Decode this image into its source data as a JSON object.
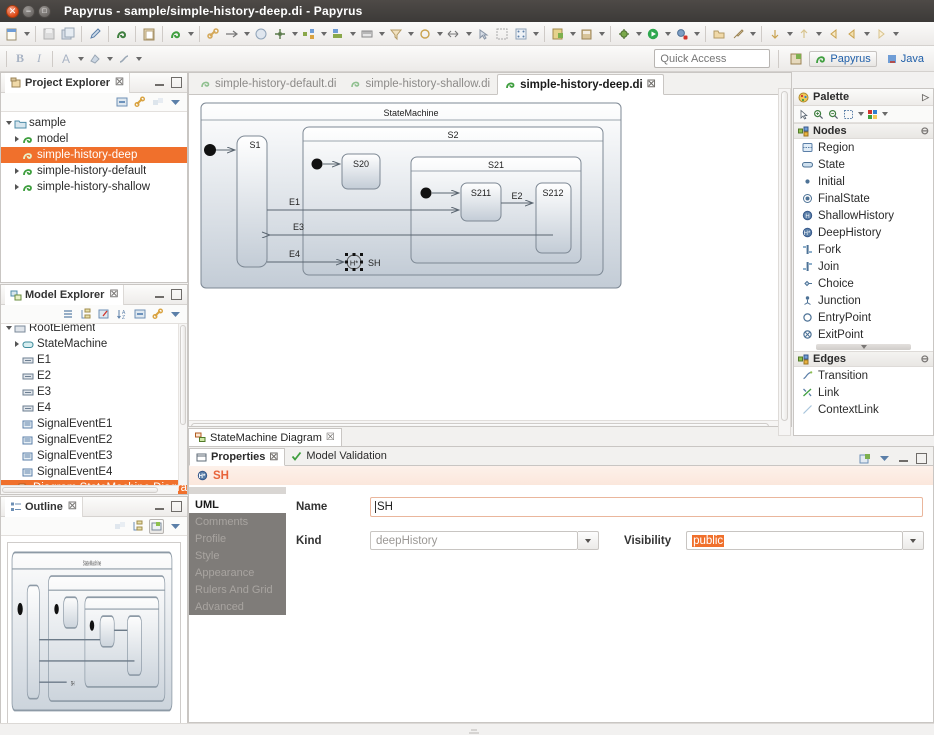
{
  "window": {
    "title": "Papyrus - sample/simple-history-deep.di - Papyrus",
    "buttons": {
      "close": "close-button",
      "minimize": "minimize-button",
      "maximize": "maximize-button"
    }
  },
  "toolbar": {
    "quick_access_placeholder": "Quick Access",
    "perspectives": [
      {
        "label": "Papyrus",
        "icon": "papyrus-icon",
        "active": true
      },
      {
        "label": "Java",
        "icon": "java-icon",
        "active": false
      }
    ],
    "open_perspective_label": "",
    "format": {
      "bold": "B",
      "italic": "I"
    }
  },
  "project_explorer": {
    "title": "Project Explorer",
    "close_glyph": "☒",
    "toolbar_icons": [
      "collapse-all-icon",
      "link-with-editor-icon",
      "view-menu-icon",
      "view-menu-chevron-icon"
    ],
    "items": [
      {
        "label": "sample",
        "depth": 0,
        "twisty": "down",
        "icon": "project-folder-icon",
        "selected": false
      },
      {
        "label": "model",
        "depth": 1,
        "twisty": "right",
        "icon": "papyrus-model-icon",
        "selected": false
      },
      {
        "label": "simple-history-deep",
        "depth": 1,
        "twisty": "none",
        "icon": "papyrus-model-icon",
        "selected": true
      },
      {
        "label": "simple-history-default",
        "depth": 1,
        "twisty": "right",
        "icon": "papyrus-model-icon",
        "selected": false
      },
      {
        "label": "simple-history-shallow",
        "depth": 1,
        "twisty": "right",
        "icon": "papyrus-model-icon",
        "selected": false
      }
    ]
  },
  "model_explorer": {
    "title": "Model Explorer",
    "close_glyph": "☒",
    "toolbar_icons": [
      "list-icon",
      "tree-icon",
      "edit-icon",
      "sort-icon",
      "collapse-all-icon",
      "link-icon",
      "view-menu-chevron-icon"
    ],
    "items": [
      {
        "label": "RootElement",
        "depth": 0,
        "twisty": "down",
        "icon": "model-icon",
        "selected": false,
        "clipped": true
      },
      {
        "label": "StateMachine",
        "depth": 1,
        "twisty": "right",
        "icon": "statemachine-icon",
        "selected": false
      },
      {
        "label": "E1",
        "depth": 1,
        "twisty": "none",
        "icon": "signal-icon",
        "selected": false
      },
      {
        "label": "E2",
        "depth": 1,
        "twisty": "none",
        "icon": "signal-icon",
        "selected": false
      },
      {
        "label": "E3",
        "depth": 1,
        "twisty": "none",
        "icon": "signal-icon",
        "selected": false
      },
      {
        "label": "E4",
        "depth": 1,
        "twisty": "none",
        "icon": "signal-icon",
        "selected": false
      },
      {
        "label": "SignalEventE1",
        "depth": 1,
        "twisty": "none",
        "icon": "signal-event-icon",
        "selected": false
      },
      {
        "label": "SignalEventE2",
        "depth": 1,
        "twisty": "none",
        "icon": "signal-event-icon",
        "selected": false
      },
      {
        "label": "SignalEventE3",
        "depth": 1,
        "twisty": "none",
        "icon": "signal-event-icon",
        "selected": false
      },
      {
        "label": "SignalEventE4",
        "depth": 1,
        "twisty": "none",
        "icon": "signal-event-icon",
        "selected": false
      },
      {
        "label": "Diagram StateMachine Diagra",
        "depth": 1,
        "twisty": "none",
        "icon": "diagram-icon",
        "selected": true
      }
    ]
  },
  "outline": {
    "title": "Outline",
    "close_glyph": "☒",
    "toolbar_icons": [
      "hide-icon",
      "tree-outline-icon",
      "overview-icon",
      "view-menu-chevron-icon"
    ]
  },
  "editor": {
    "tabs": [
      {
        "label": "simple-history-default.di",
        "active": false
      },
      {
        "label": "simple-history-shallow.di",
        "active": false
      },
      {
        "label": "simple-history-deep.di",
        "active": true,
        "close_glyph": "☒"
      }
    ],
    "bottom_tab": {
      "label": "StateMachine Diagram",
      "close_glyph": "☒",
      "icon": "diagram-icon"
    }
  },
  "diagram": {
    "root_label": "StateMachine",
    "states": [
      {
        "name": "S1"
      },
      {
        "name": "S2"
      },
      {
        "name": "S20"
      },
      {
        "name": "S21"
      },
      {
        "name": "S211"
      },
      {
        "name": "S212"
      }
    ],
    "transitions": [
      {
        "label": "E1"
      },
      {
        "label": "E2"
      },
      {
        "label": "E3"
      },
      {
        "label": "E4"
      }
    ],
    "history_node": {
      "label": "SH",
      "kind": "deepHistory",
      "selected": true
    }
  },
  "palette": {
    "title": "Palette",
    "pin_glyph": "▷",
    "tools": [
      "select-tool-icon",
      "zoom-in-icon",
      "zoom-out-icon",
      "marquee-icon",
      "marquee-caret-icon",
      "format-icon",
      "format-caret-icon"
    ],
    "groups": [
      {
        "name": "Nodes",
        "collapse_glyph": "⊖",
        "items": [
          {
            "label": "Region",
            "icon": "region-icon"
          },
          {
            "label": "State",
            "icon": "state-icon"
          },
          {
            "label": "Initial",
            "icon": "initial-icon"
          },
          {
            "label": "FinalState",
            "icon": "finalstate-icon"
          },
          {
            "label": "ShallowHistory",
            "icon": "shallowhistory-icon"
          },
          {
            "label": "DeepHistory",
            "icon": "deephistory-icon"
          },
          {
            "label": "Fork",
            "icon": "fork-icon"
          },
          {
            "label": "Join",
            "icon": "join-icon"
          },
          {
            "label": "Choice",
            "icon": "choice-icon"
          },
          {
            "label": "Junction",
            "icon": "junction-icon"
          },
          {
            "label": "EntryPoint",
            "icon": "entrypoint-icon"
          },
          {
            "label": "ExitPoint",
            "icon": "exitpoint-icon"
          }
        ]
      },
      {
        "name": "Edges",
        "collapse_glyph": "⊖",
        "items": [
          {
            "label": "Transition",
            "icon": "transition-icon"
          },
          {
            "label": "Link",
            "icon": "link-icon"
          },
          {
            "label": "ContextLink",
            "icon": "contextlink-icon"
          }
        ]
      }
    ]
  },
  "properties": {
    "tabs": [
      {
        "label": "Properties",
        "active": true,
        "close_glyph": "☒",
        "icon": "properties-icon"
      },
      {
        "label": "Model Validation",
        "active": false,
        "icon": "validation-check-icon"
      }
    ],
    "header_icons": [
      "new-properties-view-icon",
      "view-menu-chevron-icon",
      "minimize-icon",
      "maximize-icon"
    ],
    "selected_element": {
      "label": "SH",
      "icon": "deephistory-icon"
    },
    "side_tabs": [
      {
        "label": "UML",
        "active": true
      },
      {
        "label": "Comments",
        "active": false
      },
      {
        "label": "Profile",
        "active": false
      },
      {
        "label": "Style",
        "active": false
      },
      {
        "label": "Appearance",
        "active": false
      },
      {
        "label": "Rulers And Grid",
        "active": false
      },
      {
        "label": "Advanced",
        "active": false
      }
    ],
    "fields": {
      "name_label": "Name",
      "name_value": "SH",
      "kind_label": "Kind",
      "kind_value": "deepHistory",
      "visibility_label": "Visibility",
      "visibility_value": "public"
    }
  },
  "colors": {
    "selection_orange": "#f0702c",
    "link_blue": "#1f5fa9",
    "titlebar": "#413d3b"
  }
}
